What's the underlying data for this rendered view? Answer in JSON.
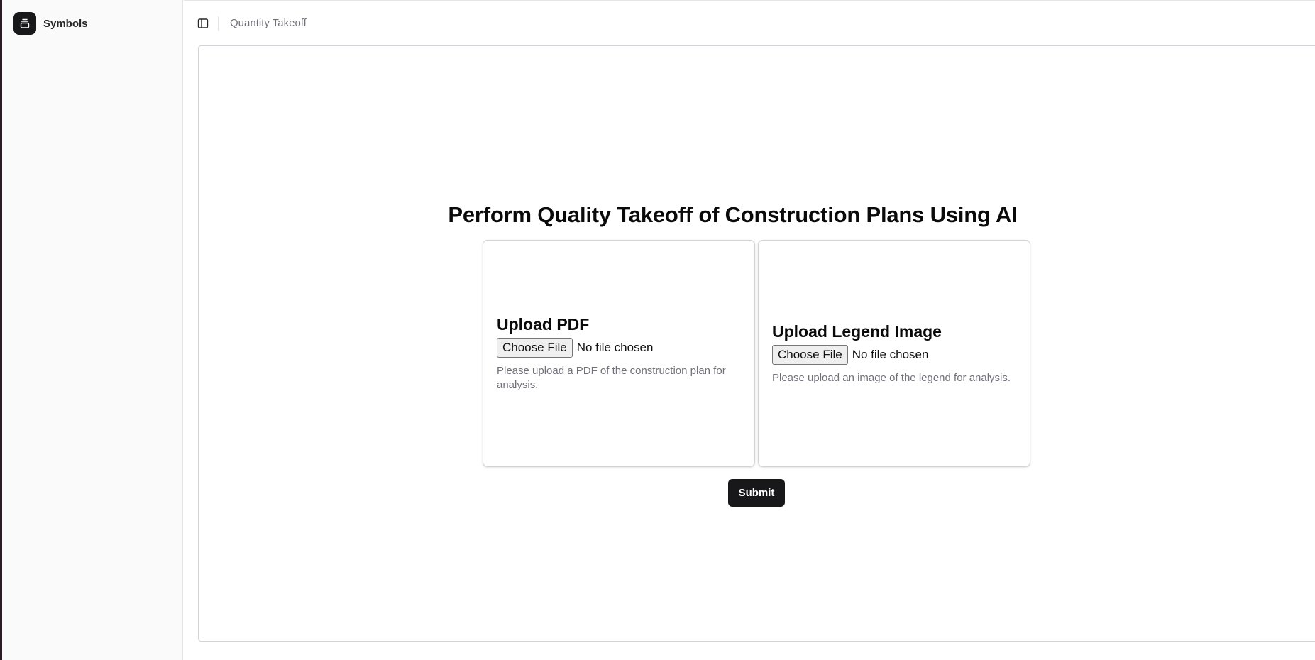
{
  "sidebar": {
    "brand_name": "Symbols",
    "brand_icon": "stack-icon"
  },
  "topbar": {
    "toggle_icon": "sidebar-toggle-icon",
    "breadcrumb": "Quantity Takeoff"
  },
  "main": {
    "title": "Perform Quality Takeoff of Construction Plans Using AI",
    "cards": [
      {
        "title": "Upload PDF",
        "button_label": "Choose File",
        "file_status": "No file chosen",
        "help": "Please upload a PDF of the construction plan for analysis."
      },
      {
        "title": "Upload Legend Image",
        "button_label": "Choose File",
        "file_status": "No file chosen",
        "help": "Please upload an image of the legend for analysis."
      }
    ],
    "submit_label": "Submit"
  },
  "colors": {
    "primary": "#18181b",
    "muted_text": "#71717a",
    "border": "#d4d4d8",
    "sidebar_bg": "#fafafa"
  }
}
